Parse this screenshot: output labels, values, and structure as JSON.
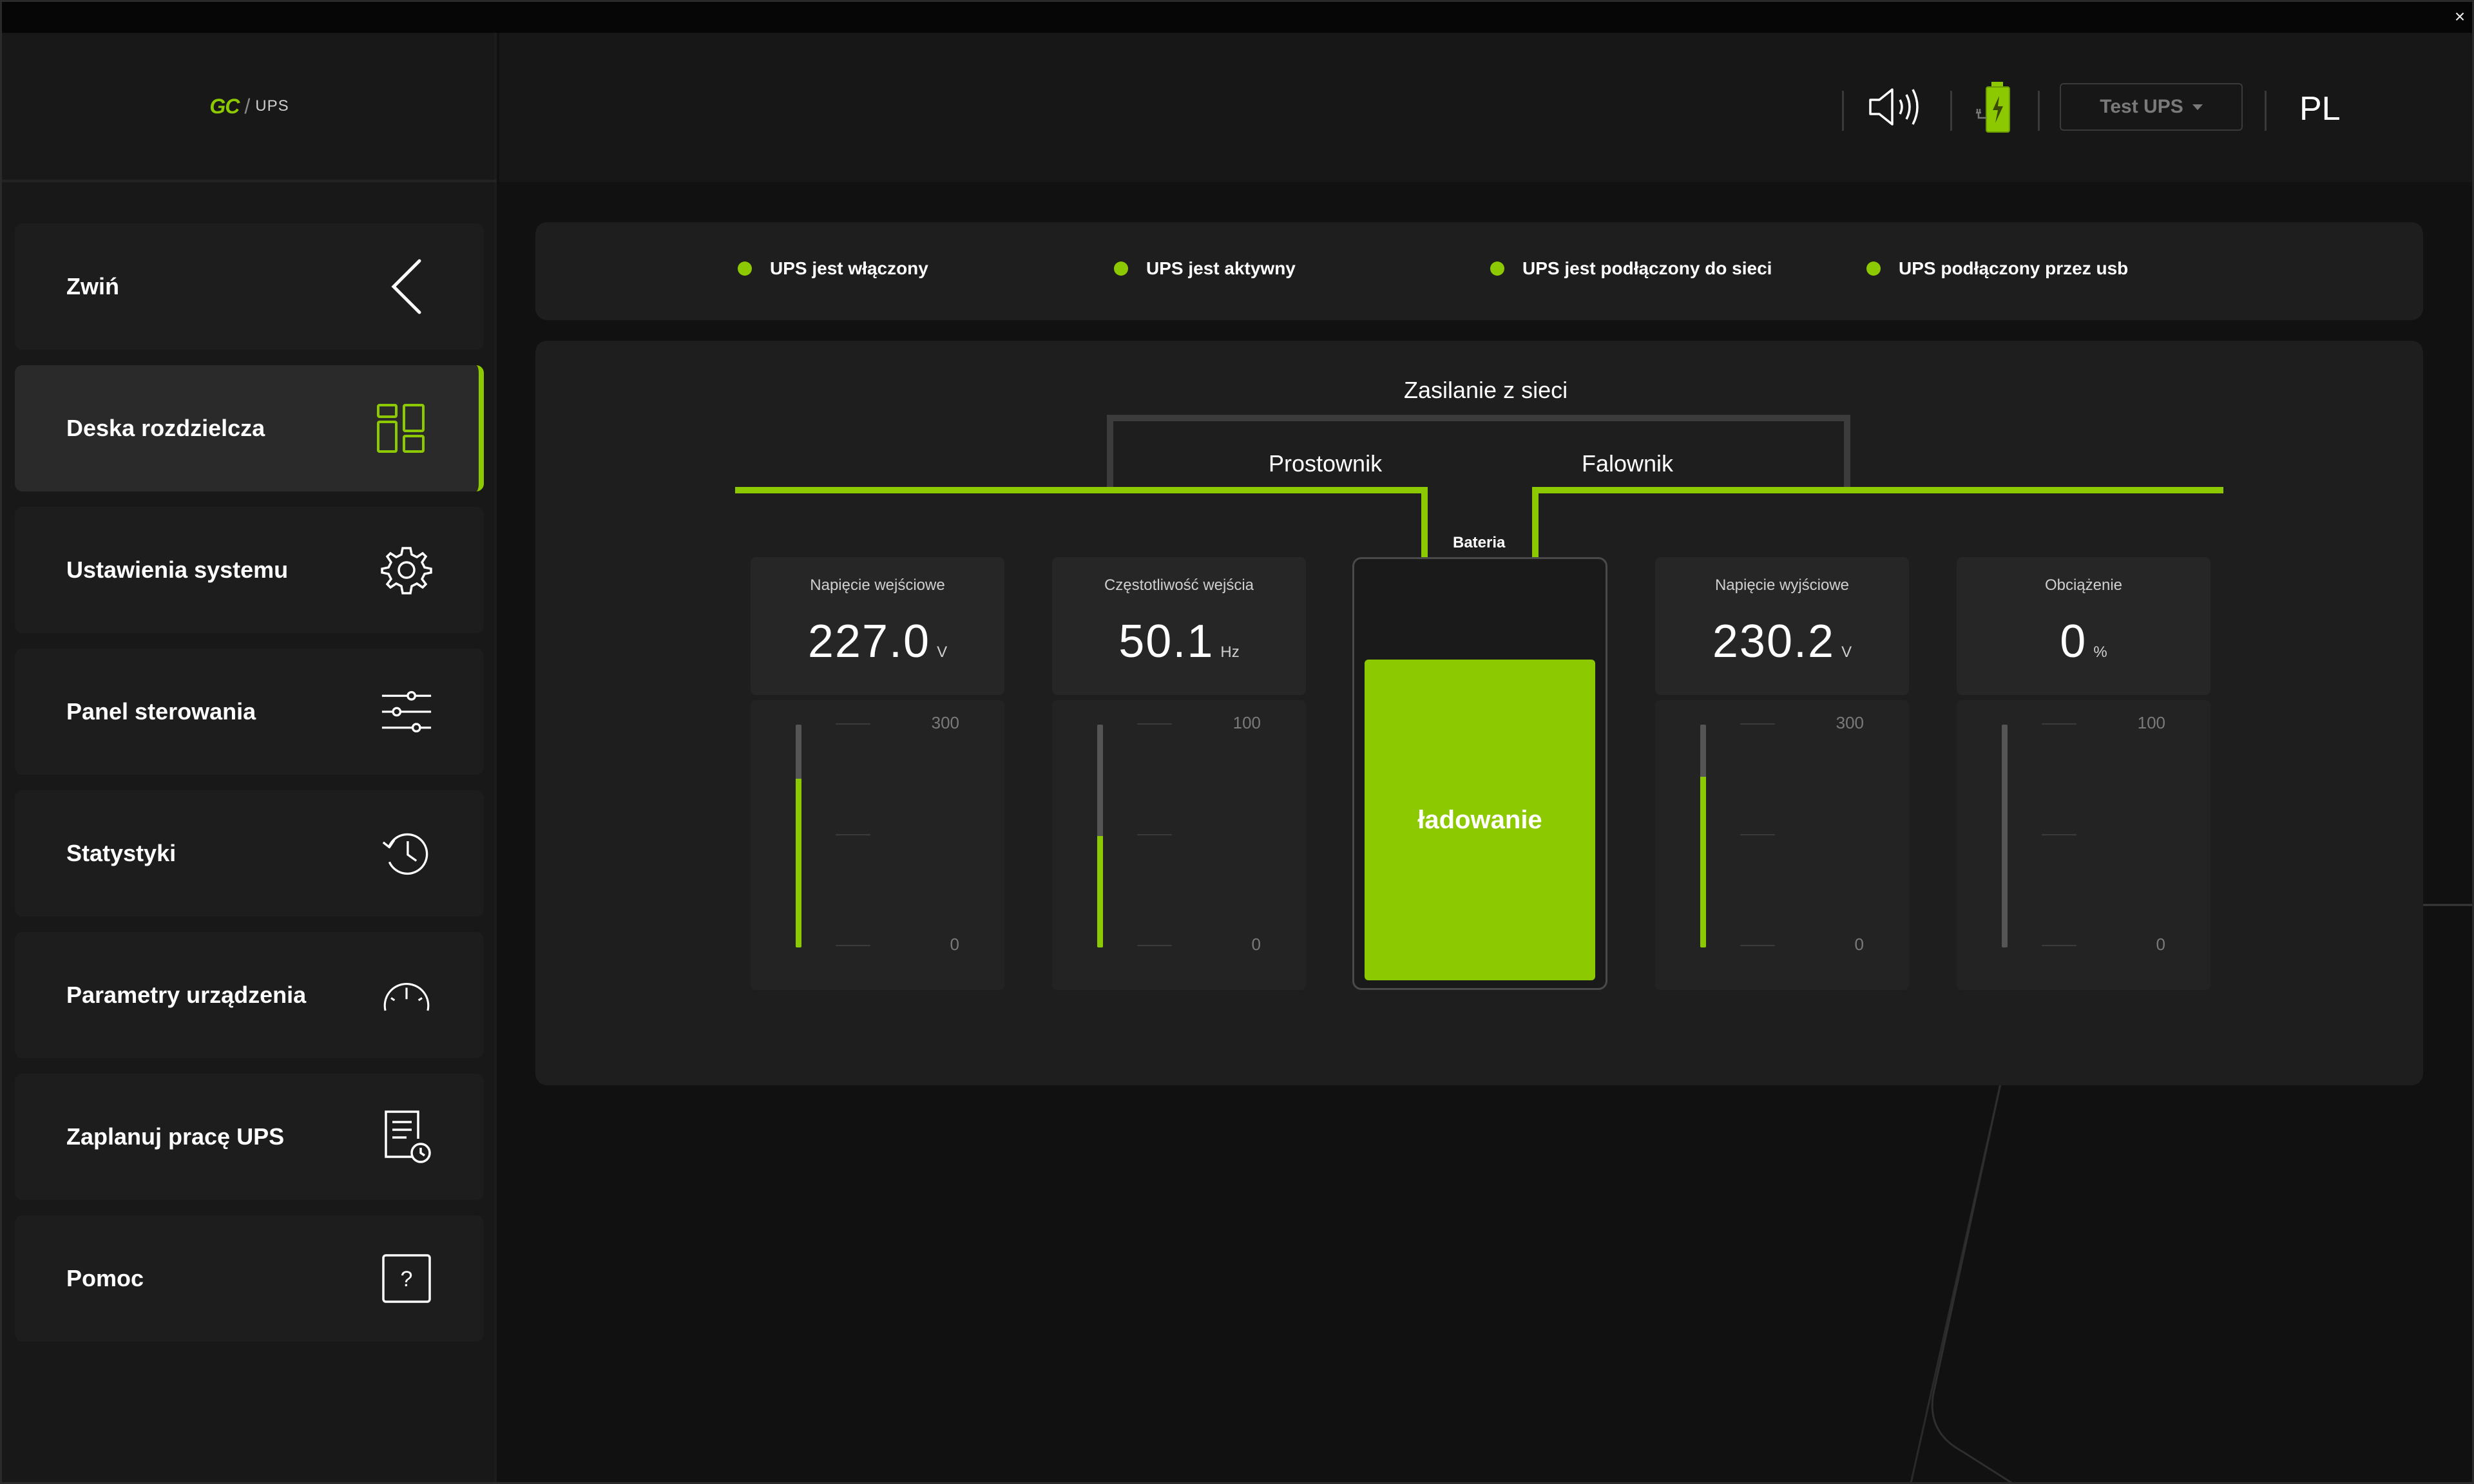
{
  "app": {
    "logo": {
      "brand": "GC",
      "product": "UPS"
    },
    "close_glyph": "×"
  },
  "header": {
    "test_button_label": "Test UPS",
    "language": "PL"
  },
  "sidebar": {
    "items": [
      {
        "label": "Zwiń",
        "icon": "chevron-left-icon"
      },
      {
        "label": "Deska rozdzielcza",
        "icon": "dashboard-icon",
        "active": true
      },
      {
        "label": "Ustawienia systemu",
        "icon": "gear-icon"
      },
      {
        "label": "Panel sterowania",
        "icon": "sliders-icon"
      },
      {
        "label": "Statystyki",
        "icon": "history-icon"
      },
      {
        "label": "Parametry urządzenia",
        "icon": "gauge-icon"
      },
      {
        "label": "Zaplanuj pracę UPS",
        "icon": "schedule-icon"
      },
      {
        "label": "Pomoc",
        "icon": "help-icon"
      }
    ]
  },
  "status": [
    "UPS jest włączony",
    "UPS jest aktywny",
    "UPS jest podłączony do sieci",
    "UPS podłączony przez usb"
  ],
  "flow": {
    "mains": "Zasilanie z sieci",
    "rectifier": "Prostownik",
    "inverter": "Falownik",
    "battery": "Bateria"
  },
  "gauges": [
    {
      "title": "Napięcie wejściowe",
      "value": "227.0",
      "unit": "V",
      "max": "300",
      "min": "0",
      "fraction": 0.757
    },
    {
      "title": "Częstotliwość wejścia",
      "value": "50.1",
      "unit": "Hz",
      "max": "100",
      "min": "0",
      "fraction": 0.501
    },
    {
      "title": "Napięcie wyjściowe",
      "value": "230.2",
      "unit": "V",
      "max": "300",
      "min": "0",
      "fraction": 0.767
    },
    {
      "title": "Obciążenie",
      "value": "0",
      "unit": "%",
      "max": "100",
      "min": "0",
      "fraction": 0.0
    }
  ],
  "battery": {
    "state": "ładowanie"
  },
  "colors": {
    "accent": "#8cc900",
    "panel": "#1e1e1e",
    "background": "#111111"
  }
}
